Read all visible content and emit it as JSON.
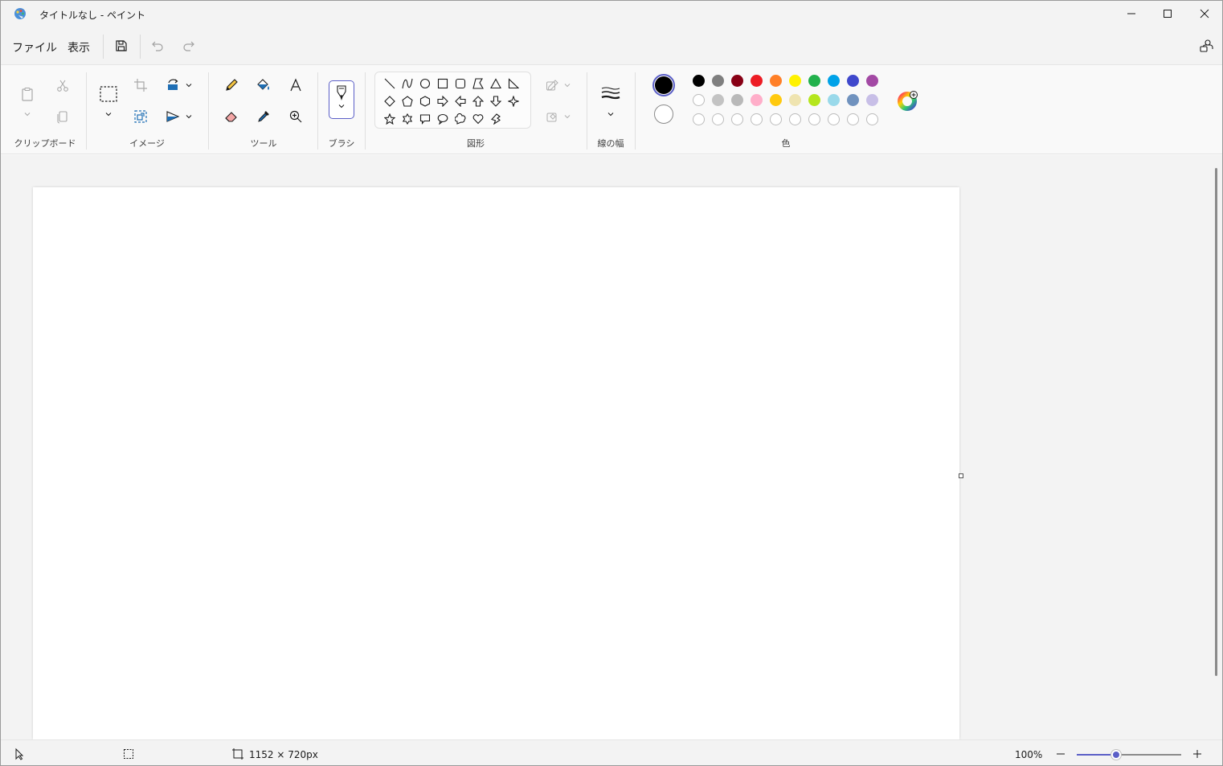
{
  "window": {
    "title": "タイトルなし - ペイント",
    "app_icon": "paint-palette-icon",
    "controls": [
      "minimize-icon",
      "maximize-icon",
      "close-icon"
    ]
  },
  "menubar": {
    "file_label": "ファイル",
    "view_label": "表示",
    "save_icon": "save-icon",
    "undo_icon": "undo-icon",
    "redo_icon": "redo-icon",
    "account_icon": "account-settings-icon"
  },
  "ribbon": {
    "groups": {
      "clipboard": "クリップボード",
      "image": "イメージ",
      "tools": "ツール",
      "brush": "ブラシ",
      "shapes": "図形",
      "size": "線の幅",
      "colors": "色"
    },
    "primary_color": "#000000",
    "secondary_color": "#ffffff",
    "palette_row1": [
      "#000000",
      "#7f7f7f",
      "#880015",
      "#ed1c24",
      "#ff7f27",
      "#fff200",
      "#22b14c",
      "#00a2e8",
      "#3f48cc",
      "#a349a4"
    ],
    "palette_row2": [
      "#ffffff",
      "#c3c3c3",
      "#b9b9b9",
      "#ffaec9",
      "#ffc90e",
      "#efe4b0",
      "#b5e61d",
      "#99d9ea",
      "#7092be",
      "#c8bfe7"
    ],
    "accent": "#5b5fc7"
  },
  "statusbar": {
    "canvas_size": "1152 × 720px",
    "zoom": "100%",
    "zoom_level_fraction": 0.38
  }
}
